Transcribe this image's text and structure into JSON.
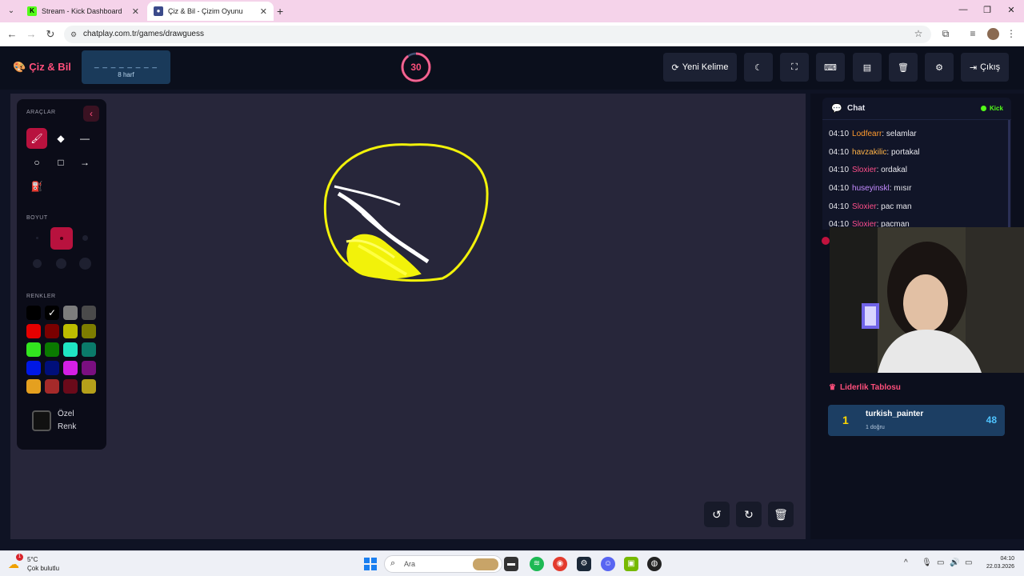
{
  "browser": {
    "tabs": [
      {
        "title": "Stream - Kick Dashboard",
        "icon": "kick-favicon"
      },
      {
        "title": "Çiz & Bil - Çizim Oyunu",
        "icon": "palette-favicon"
      }
    ],
    "url": "chatplay.com.tr/games/drawguess"
  },
  "header": {
    "brand": "Çiz & Bil",
    "word_mask": "_ _ _ _ _ _ _ _",
    "letter_count": "8 harf",
    "timer": "30",
    "timer_progress": 0.9,
    "new_word": "Yeni Kelime",
    "exit": "Çıkış"
  },
  "tools": {
    "title": "ARAÇLAR",
    "size_title": "BOYUT",
    "colors_title": "RENKLER",
    "custom_color": [
      "Özel",
      "Renk"
    ],
    "palette": [
      "#000000",
      "#ffffff",
      "#7d7d7d",
      "#4a4a4a",
      "#e50000",
      "#7a0000",
      "#bcbc00",
      "#7d7d00",
      "#32e51f",
      "#0a7a00",
      "#1fe5c4",
      "#0a7a6a",
      "#0018e5",
      "#000f7a",
      "#d41fe5",
      "#7a0f80",
      "#e5a01f",
      "#a52a2a",
      "#6a0a1a",
      "#b5a01a"
    ],
    "selected_color_index": 1
  },
  "chat": {
    "title": "Chat",
    "platform": "Kick",
    "messages": [
      {
        "time": "04:10",
        "user": "Lodfearr",
        "text": ": selamlar",
        "color": "#ff9a2e"
      },
      {
        "time": "04:10",
        "user": "havzakilic",
        "text": ": portakal",
        "color": "#ffb347"
      },
      {
        "time": "04:10",
        "user": "Sloxier",
        "text": ": ordakal",
        "color": "#ff4f8a"
      },
      {
        "time": "04:10",
        "user": "huseyinskl",
        "text": ": mısır",
        "color": "#c48bff"
      },
      {
        "time": "04:10",
        "user": "Sloxier",
        "text": ": pac man",
        "color": "#ff4f8a"
      },
      {
        "time": "04:10",
        "user": "Sloxier",
        "text": ": pacman",
        "color": "#ff4f8a"
      }
    ]
  },
  "leaderboard": {
    "title": "Liderlik Tablosu",
    "entries": [
      {
        "rank": "1",
        "name": "turkish_painter",
        "sub": "1 doğru",
        "score": "48"
      }
    ]
  },
  "taskbar": {
    "temp": "5°C",
    "condition": "Çok bulutlu",
    "search": "Ara",
    "time": "04:10",
    "date": "22.03.2026",
    "weather_badge": "1"
  }
}
